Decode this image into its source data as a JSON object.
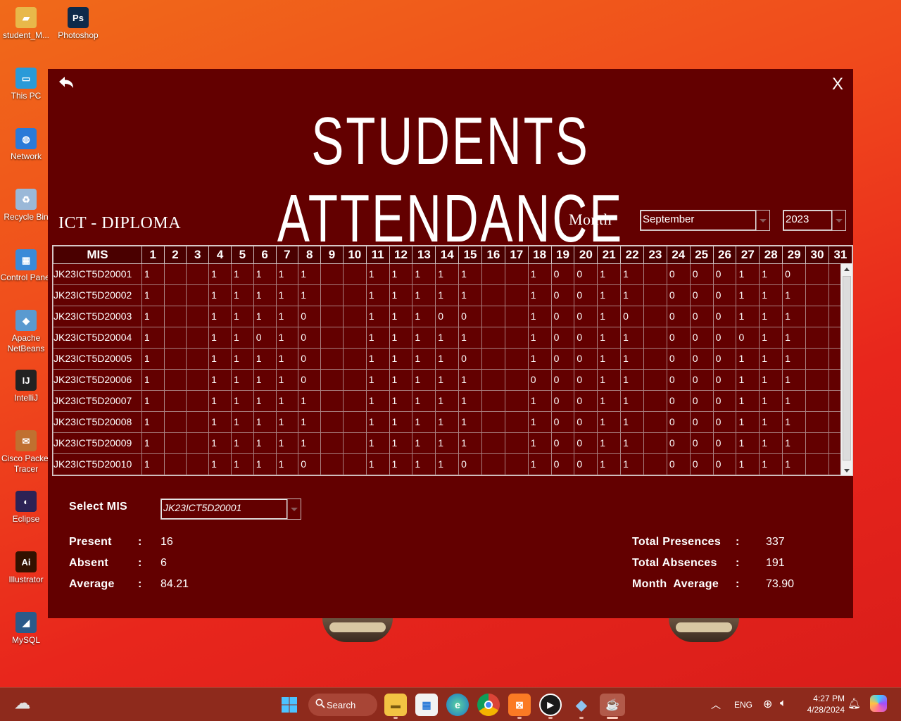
{
  "desktop": {
    "icons": [
      {
        "label": "student_M...",
        "color": "#e8b84a",
        "glyph": "▰"
      },
      {
        "label": "Photoshop",
        "color": "#0e2a4a",
        "glyph": "Ps"
      },
      {
        "label": "This PC",
        "color": "#2a9ad8",
        "glyph": "▭"
      },
      {
        "label": "Network",
        "color": "#2a7ad8",
        "glyph": "◍"
      },
      {
        "label": "Recycle Bin",
        "color": "#9ab8d8",
        "glyph": "♻"
      },
      {
        "label": "Control Panel",
        "color": "#3a8ad8",
        "glyph": "▦"
      },
      {
        "label": "Apache NetBeans",
        "color": "#5a9ad0",
        "glyph": "◆"
      },
      {
        "label": "IntelliJ",
        "color": "#222222",
        "glyph": "IJ"
      },
      {
        "label": "Cisco Packet Tracer",
        "color": "#c07030",
        "glyph": "✉"
      },
      {
        "label": "Eclipse",
        "color": "#2c2255",
        "glyph": "◐"
      },
      {
        "label": "Illustrator",
        "color": "#331100",
        "glyph": "Ai"
      },
      {
        "label": "MySQL",
        "color": "#2a5a8a",
        "glyph": "◢"
      }
    ]
  },
  "app": {
    "title": "STUDENTS ATTENDANCE",
    "department": "ICT - DIPLOMA",
    "month_label": "Month",
    "month_value": "September",
    "year_value": "2023",
    "close_label": "X"
  },
  "table": {
    "mis_header": "MIS",
    "day_headers": [
      "1",
      "2",
      "3",
      "4",
      "5",
      "6",
      "7",
      "8",
      "9",
      "10",
      "11",
      "12",
      "13",
      "14",
      "15",
      "16",
      "17",
      "18",
      "19",
      "20",
      "21",
      "22",
      "23",
      "24",
      "25",
      "26",
      "27",
      "28",
      "29",
      "30",
      "31"
    ],
    "rows": [
      {
        "mis": "JK23ICT5D20001",
        "days": [
          "1",
          "",
          "",
          "1",
          "1",
          "1",
          "1",
          "1",
          "",
          "",
          "1",
          "1",
          "1",
          "1",
          "1",
          "",
          "",
          "1",
          "0",
          "0",
          "1",
          "1",
          "",
          "0",
          "0",
          "0",
          "1",
          "1",
          "0",
          "",
          ""
        ]
      },
      {
        "mis": "JK23ICT5D20002",
        "days": [
          "1",
          "",
          "",
          "1",
          "1",
          "1",
          "1",
          "1",
          "",
          "",
          "1",
          "1",
          "1",
          "1",
          "1",
          "",
          "",
          "1",
          "0",
          "0",
          "1",
          "1",
          "",
          "0",
          "0",
          "0",
          "1",
          "1",
          "1",
          "",
          ""
        ]
      },
      {
        "mis": "JK23ICT5D20003",
        "days": [
          "1",
          "",
          "",
          "1",
          "1",
          "1",
          "1",
          "0",
          "",
          "",
          "1",
          "1",
          "1",
          "0",
          "0",
          "",
          "",
          "1",
          "0",
          "0",
          "1",
          "0",
          "",
          "0",
          "0",
          "0",
          "1",
          "1",
          "1",
          "",
          ""
        ]
      },
      {
        "mis": "JK23ICT5D20004",
        "days": [
          "1",
          "",
          "",
          "1",
          "1",
          "0",
          "1",
          "0",
          "",
          "",
          "1",
          "1",
          "1",
          "1",
          "1",
          "",
          "",
          "1",
          "0",
          "0",
          "1",
          "1",
          "",
          "0",
          "0",
          "0",
          "0",
          "1",
          "1",
          "",
          ""
        ]
      },
      {
        "mis": "JK23ICT5D20005",
        "days": [
          "1",
          "",
          "",
          "1",
          "1",
          "1",
          "1",
          "0",
          "",
          "",
          "1",
          "1",
          "1",
          "1",
          "0",
          "",
          "",
          "1",
          "0",
          "0",
          "1",
          "1",
          "",
          "0",
          "0",
          "0",
          "1",
          "1",
          "1",
          "",
          ""
        ]
      },
      {
        "mis": "JK23ICT5D20006",
        "days": [
          "1",
          "",
          "",
          "1",
          "1",
          "1",
          "1",
          "0",
          "",
          "",
          "1",
          "1",
          "1",
          "1",
          "1",
          "",
          "",
          "0",
          "0",
          "0",
          "1",
          "1",
          "",
          "0",
          "0",
          "0",
          "1",
          "1",
          "1",
          "",
          ""
        ]
      },
      {
        "mis": "JK23ICT5D20007",
        "days": [
          "1",
          "",
          "",
          "1",
          "1",
          "1",
          "1",
          "1",
          "",
          "",
          "1",
          "1",
          "1",
          "1",
          "1",
          "",
          "",
          "1",
          "0",
          "0",
          "1",
          "1",
          "",
          "0",
          "0",
          "0",
          "1",
          "1",
          "1",
          "",
          ""
        ]
      },
      {
        "mis": "JK23ICT5D20008",
        "days": [
          "1",
          "",
          "",
          "1",
          "1",
          "1",
          "1",
          "1",
          "",
          "",
          "1",
          "1",
          "1",
          "1",
          "1",
          "",
          "",
          "1",
          "0",
          "0",
          "1",
          "1",
          "",
          "0",
          "0",
          "0",
          "1",
          "1",
          "1",
          "",
          ""
        ]
      },
      {
        "mis": "JK23ICT5D20009",
        "days": [
          "1",
          "",
          "",
          "1",
          "1",
          "1",
          "1",
          "1",
          "",
          "",
          "1",
          "1",
          "1",
          "1",
          "1",
          "",
          "",
          "1",
          "0",
          "0",
          "1",
          "1",
          "",
          "0",
          "0",
          "0",
          "1",
          "1",
          "1",
          "",
          ""
        ]
      },
      {
        "mis": "JK23ICT5D20010",
        "days": [
          "1",
          "",
          "",
          "1",
          "1",
          "1",
          "1",
          "0",
          "",
          "",
          "1",
          "1",
          "1",
          "1",
          "0",
          "",
          "",
          "1",
          "0",
          "0",
          "1",
          "1",
          "",
          "0",
          "0",
          "0",
          "1",
          "1",
          "1",
          "",
          ""
        ]
      }
    ]
  },
  "student_stats": {
    "select_label": "Select MIS",
    "selected_mis": "JK23ICT5D20001",
    "present_label": "Present",
    "present_value": "16",
    "absent_label": "Absent",
    "absent_value": "6",
    "average_label": "Average",
    "average_value": "84.21",
    "colon": ":"
  },
  "month_stats": {
    "total_presences_label": "Total Presences",
    "total_presences_value": "337",
    "total_absences_label": "Total Absences",
    "total_absences_value": "191",
    "month_average_label": "Month  Average",
    "month_average_value": "73.90"
  },
  "taskbar": {
    "search_label": "Search",
    "language": "ENG",
    "time": "4:27 PM",
    "date": "4/28/2024"
  }
}
